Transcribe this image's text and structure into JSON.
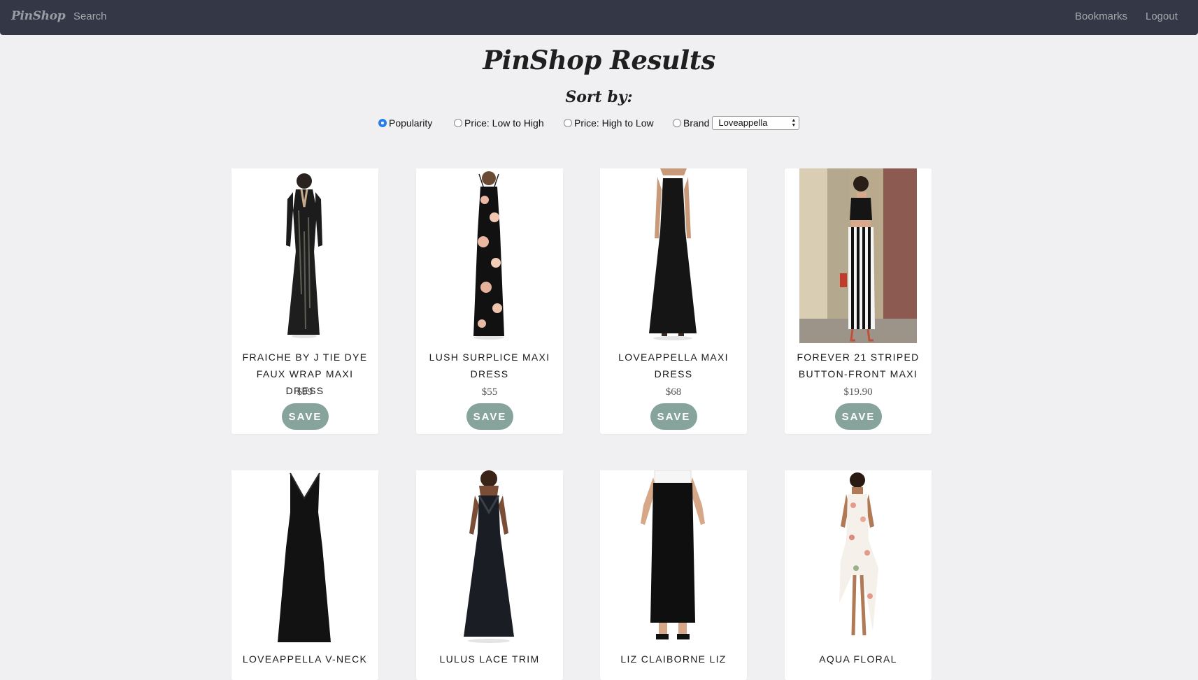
{
  "nav": {
    "brand": "PinShop",
    "search": "Search",
    "bookmarks": "Bookmarks",
    "logout": "Logout"
  },
  "page": {
    "title": "PinShop Results",
    "sort_heading": "Sort by:"
  },
  "sort": {
    "options": [
      {
        "label": "Popularity",
        "checked": true
      },
      {
        "label": "Price: Low to High",
        "checked": false
      },
      {
        "label": "Price: High to Low",
        "checked": false
      },
      {
        "label": "Brand",
        "checked": false
      }
    ],
    "brand_selected": "Loveappella"
  },
  "products": [
    {
      "title": "FRAICHE BY J TIE DYE FAUX WRAP MAXI DRESS",
      "price": "$99",
      "save": "SAVE"
    },
    {
      "title": "LUSH SURPLICE MAXI DRESS",
      "price": "$55",
      "save": "SAVE"
    },
    {
      "title": "LOVEAPPELLA MAXI DRESS",
      "price": "$68",
      "save": "SAVE"
    },
    {
      "title": "FOREVER 21 STRIPED BUTTON-FRONT MAXI",
      "price": "$19.90",
      "save": "SAVE"
    },
    {
      "title": "LOVEAPPELLA V-NECK",
      "price": "",
      "save": ""
    },
    {
      "title": "LULUS LACE TRIM",
      "price": "",
      "save": ""
    },
    {
      "title": "LIZ CLAIBORNE LIZ",
      "price": "",
      "save": ""
    },
    {
      "title": "AQUA FLORAL",
      "price": "",
      "save": ""
    }
  ],
  "colors": {
    "navbar": "#343746",
    "background": "#f0f0f3",
    "save_button": "#86a49c",
    "radio_checked": "#2b7de9"
  }
}
